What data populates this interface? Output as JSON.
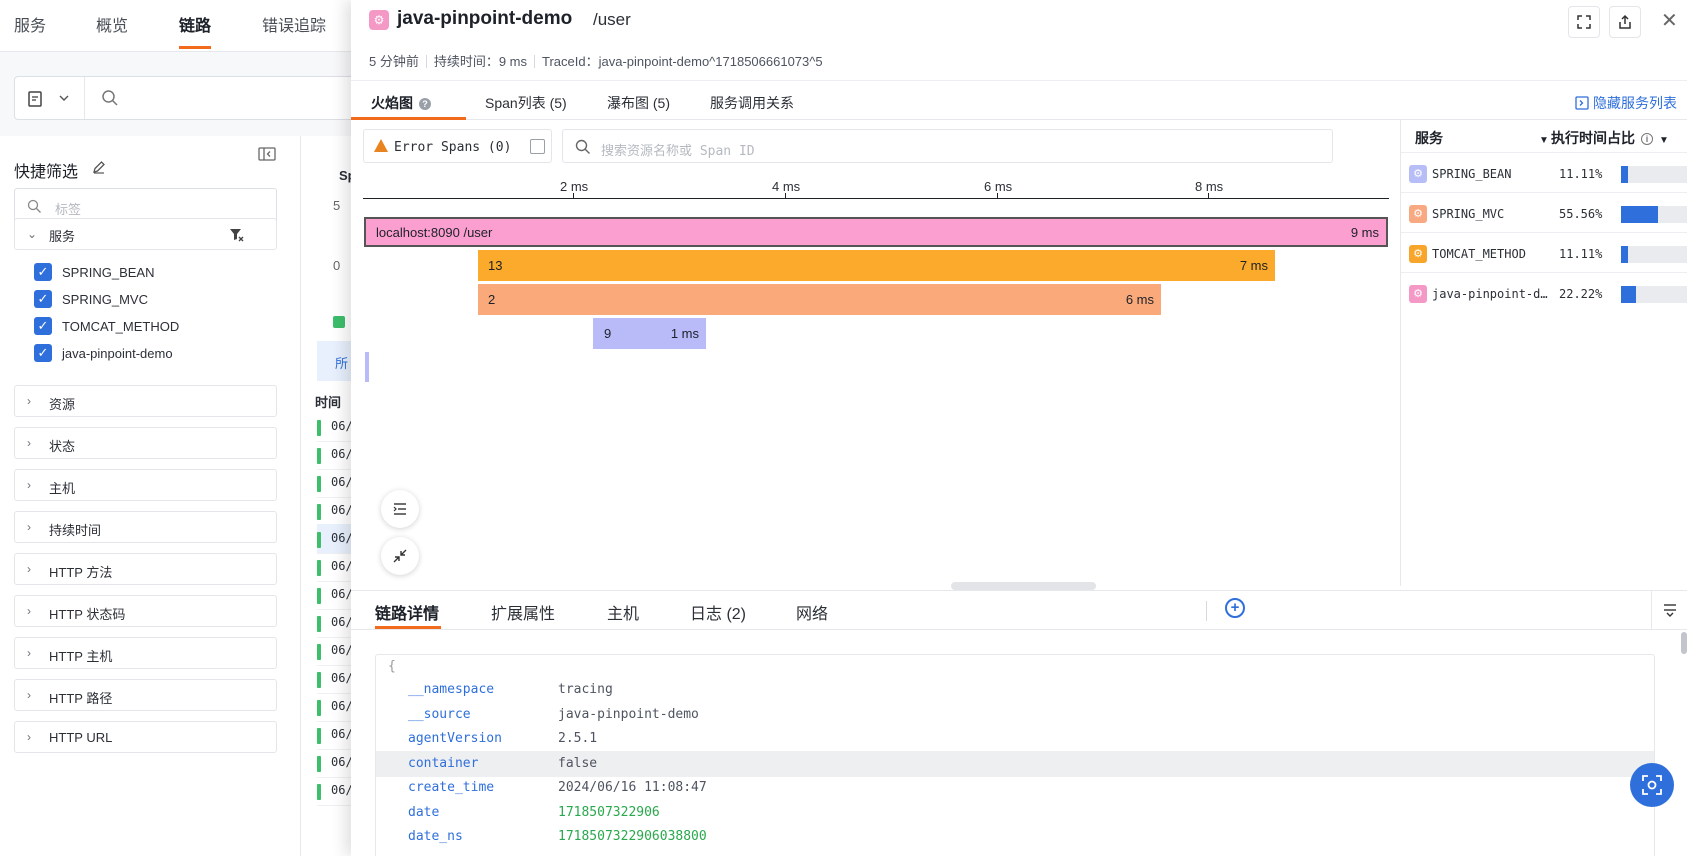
{
  "background": {
    "nav_tabs": [
      "服务",
      "概览",
      "链路",
      "错误追踪"
    ],
    "sidebar_title": "快捷筛选",
    "sidebar_search_placeholder": "标签",
    "service_group_label": "服务",
    "services": [
      "SPRING_BEAN",
      "SPRING_MVC",
      "TOMCAT_METHOD",
      "java-pinpoint-demo"
    ],
    "filter_groups": [
      "资源",
      "状态",
      "主机",
      "持续时间",
      "HTTP 方法",
      "HTTP 状态码",
      "HTTP 主机",
      "HTTP 路径",
      "HTTP URL"
    ],
    "list_fragments": {
      "sp_tab": "Sp",
      "count_5": "5",
      "count_0": "0",
      "all_tab": "所",
      "time_header": "时间",
      "row_time_prefix": "06/"
    }
  },
  "drawer": {
    "service": "java-pinpoint-demo",
    "resource": "/user",
    "meta": {
      "ago": "5 分钟前",
      "duration": "持续时间：9 ms",
      "trace_id": "TraceId：java-pinpoint-demo^1718506661073^5"
    },
    "tabs": [
      "火焰图",
      "Span列表 (5)",
      "瀑布图 (5)",
      "服务调用关系"
    ],
    "hide_service_list": "隐藏服务列表",
    "error_spans_label": "Error Spans (0)",
    "search_placeholder": "搜索资源名称或 Span ID",
    "axis_ticks": [
      "2 ms",
      "4 ms",
      "6 ms",
      "8 ms"
    ],
    "flame_spans": [
      {
        "label": "localhost:8090 /user",
        "duration": "9 ms"
      },
      {
        "label": "13",
        "duration": "7 ms"
      },
      {
        "label": "2",
        "duration": "6 ms"
      },
      {
        "label": "9",
        "duration": "1 ms"
      }
    ],
    "service_panel": {
      "header_service": "服务",
      "header_exec": "执行时间占比",
      "rows": [
        {
          "name": "SPRING_BEAN",
          "pct": "11.11%",
          "fraction": 0.1111,
          "color": "#b7bdf7"
        },
        {
          "name": "SPRING_MVC",
          "pct": "55.56%",
          "fraction": 0.5556,
          "color": "#f8a981"
        },
        {
          "name": "TOMCAT_METHOD",
          "pct": "11.11%",
          "fraction": 0.1111,
          "color": "#f8a52b"
        },
        {
          "name": "java-pinpoint-demo",
          "pct": "22.22%",
          "fraction": 0.2222,
          "color": "#f498c6"
        }
      ]
    },
    "detail_tabs": [
      "链路详情",
      "扩展属性",
      "主机",
      "日志 (2)",
      "网络"
    ],
    "json_open": "{",
    "attributes": [
      {
        "key": "__namespace",
        "value": "tracing"
      },
      {
        "key": "__source",
        "value": "java-pinpoint-demo"
      },
      {
        "key": "agentVersion",
        "value": "2.5.1"
      },
      {
        "key": "container",
        "value": "false"
      },
      {
        "key": "create_time",
        "value": "2024/06/16 11:08:47"
      },
      {
        "key": "date",
        "value": "1718507322906"
      },
      {
        "key": "date_ns",
        "value": "1718507322906038800"
      }
    ]
  },
  "colors": {
    "accent_orange": "#f26b1d",
    "link_blue": "#2f6fdb",
    "span_root": "#fb9fd1",
    "span_orange": "#fbaa2b",
    "span_salmon": "#f9a97a",
    "span_lavender": "#b8bbf8"
  }
}
